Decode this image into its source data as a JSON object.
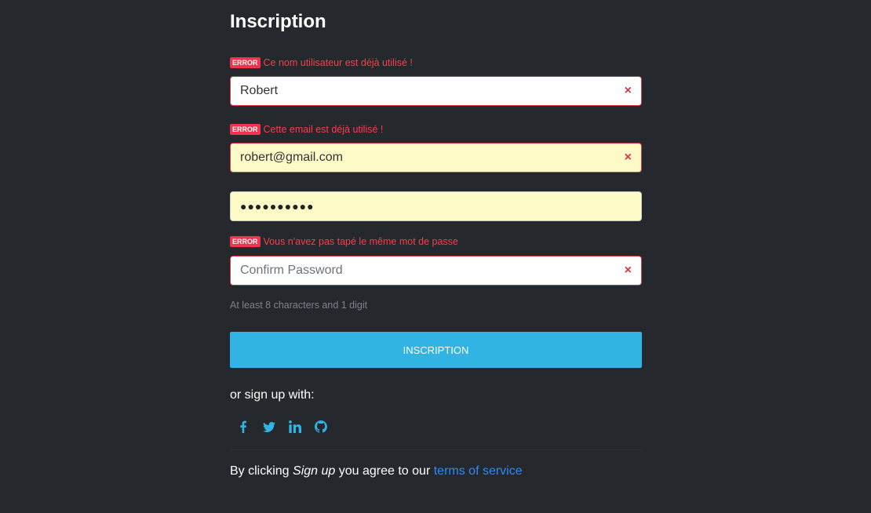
{
  "title": "Inscription",
  "colors": {
    "background": "#25282c",
    "error": "#ff3b4e",
    "accent": "#31b3e3",
    "link": "#2f8bf0",
    "social": "#31b3e3"
  },
  "fields": {
    "username": {
      "error_badge": "ERROR",
      "error_text": "Ce nom utilisateur est déjà utilisé !",
      "value": "Robert",
      "clear_icon": "×"
    },
    "email": {
      "error_badge": "ERROR",
      "error_text": "Cette email est déjà utilisé !",
      "value": "robert@gmail.com",
      "clear_icon": "×"
    },
    "password": {
      "masked_value": "●●●●●●●●●●"
    },
    "confirm": {
      "error_badge": "ERROR",
      "error_text": "Vous n'avez pas tapé le même mot de passe",
      "placeholder": "Confirm Password",
      "clear_icon": "×"
    }
  },
  "hint": "At least 8 characters and 1 digit",
  "submit_label": "INSCRIPTION",
  "alt_signup": "or sign up with:",
  "social_icons": [
    "facebook-icon",
    "twitter-icon",
    "linkedin-icon",
    "github-icon"
  ],
  "terms": {
    "prefix": "By clicking ",
    "emphasis": "Sign up",
    "middle": " you agree to our ",
    "link": "terms of service"
  }
}
